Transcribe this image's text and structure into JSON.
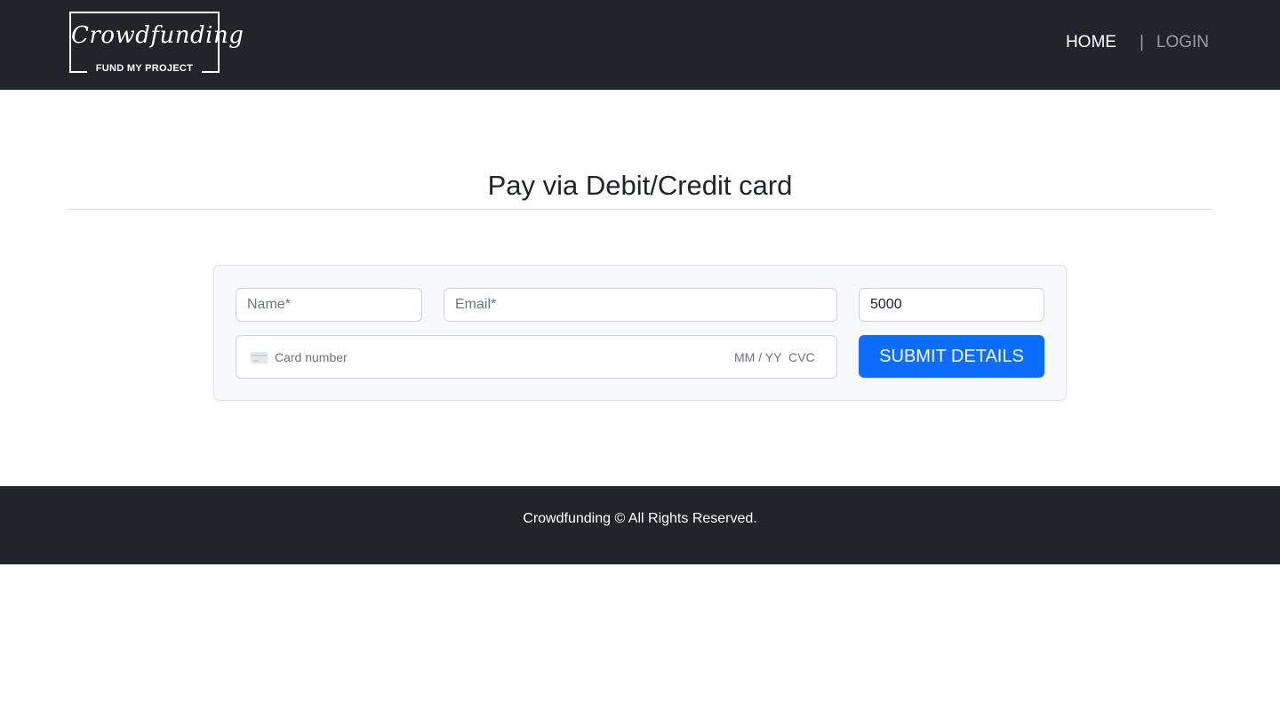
{
  "navbar": {
    "logo": {
      "title": "Crowdfunding",
      "tagline": "FUND MY PROJECT"
    },
    "links": {
      "home": "HOME",
      "separator": "|",
      "login": "LOGIN"
    }
  },
  "main": {
    "title": "Pay via Debit/Credit card"
  },
  "form": {
    "name": {
      "placeholder": "Name*",
      "value": ""
    },
    "email": {
      "placeholder": "Email*",
      "value": ""
    },
    "amount": {
      "placeholder": "",
      "value": "5000"
    },
    "card": {
      "icon": "credit-card-icon",
      "number_placeholder": "Card number",
      "expiry_placeholder": "MM / YY",
      "cvc_placeholder": "CVC"
    },
    "submit_label": "SUBMIT DETAILS"
  },
  "footer": {
    "text": "Crowdfunding © All Rights Reserved."
  },
  "colors": {
    "dark": "#212529",
    "primary": "#0d6efd",
    "card_bg": "#f8f9fa"
  }
}
